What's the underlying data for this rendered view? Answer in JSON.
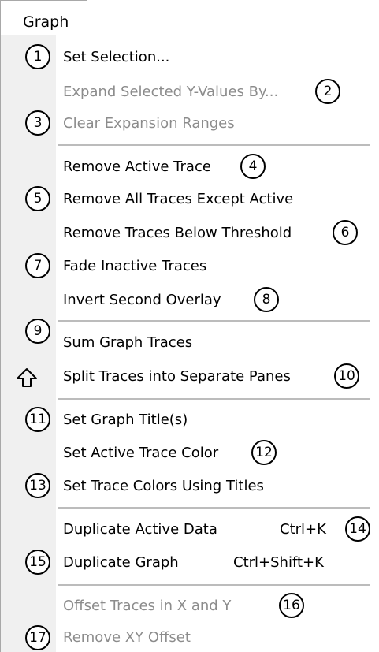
{
  "menu": {
    "title": "Graph",
    "items": [
      {
        "label": "Set Selection...",
        "enabled": true
      },
      {
        "label": "Expand Selected Y-Values By...",
        "enabled": false
      },
      {
        "label": "Clear Expansion Ranges",
        "enabled": false
      },
      {
        "label": "Remove Active Trace",
        "enabled": true
      },
      {
        "label": "Remove All Traces Except Active",
        "enabled": true
      },
      {
        "label": "Remove Traces Below Threshold",
        "enabled": true
      },
      {
        "label": "Fade Inactive Traces",
        "enabled": true
      },
      {
        "label": "Invert Second Overlay",
        "enabled": true
      },
      {
        "label": "Sum Graph Traces",
        "enabled": true
      },
      {
        "label": "Split Traces into Separate Panes",
        "enabled": true
      },
      {
        "label": "Set Graph Title(s)",
        "enabled": true
      },
      {
        "label": "Set Active Trace Color",
        "enabled": true
      },
      {
        "label": "Set Trace Colors Using Titles",
        "enabled": true
      },
      {
        "label": "Duplicate Active Data",
        "shortcut": "Ctrl+K",
        "enabled": true
      },
      {
        "label": "Duplicate Graph",
        "shortcut": "Ctrl+Shift+K",
        "enabled": true
      },
      {
        "label": "Offset Traces in X and Y",
        "enabled": false
      },
      {
        "label": "Remove XY Offset",
        "enabled": false
      }
    ]
  },
  "callouts": [
    "1",
    "2",
    "3",
    "4",
    "5",
    "6",
    "7",
    "8",
    "9",
    "10",
    "11",
    "12",
    "13",
    "14",
    "15",
    "16",
    "17"
  ],
  "icons": {
    "gutter_arrow": "up-arrow-icon"
  }
}
